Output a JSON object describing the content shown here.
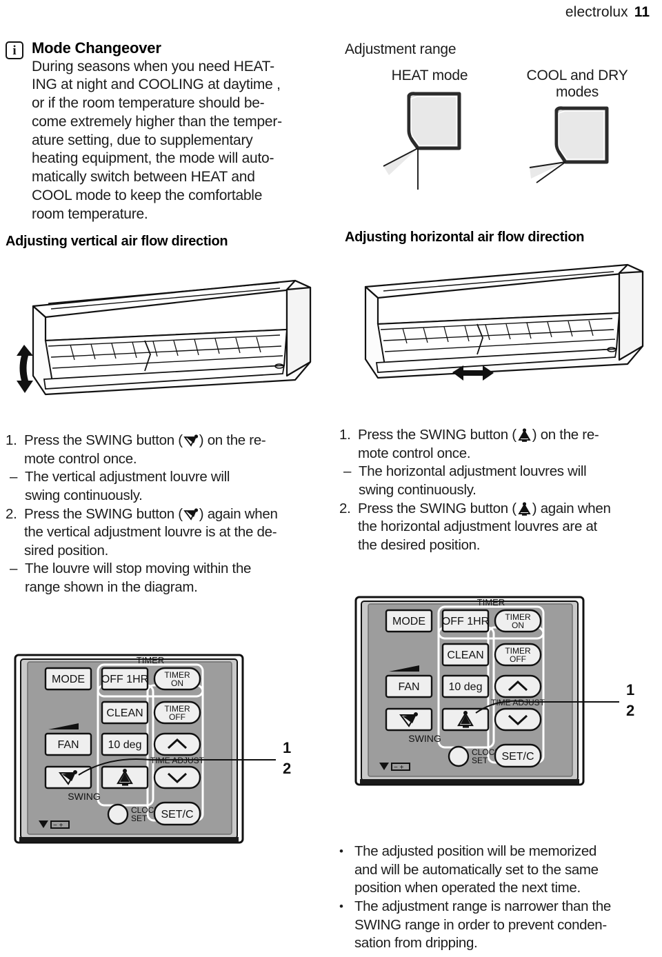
{
  "header": {
    "brand": "electrolux",
    "page_number": "11"
  },
  "note": {
    "icon": "info-icon",
    "title": "Mode Changeover",
    "body": "During seasons when you need HEAT-\nING at night and COOLING at daytime ,\nor if the room temperature should be-\ncome extremely higher than the temper-\nature setting, due to supplementary\nheating equipment, the mode will auto-\nmatically switch between HEAT and\nCOOL mode to keep the comfortable\nroom temperature."
  },
  "headings": {
    "vertical": "Adjusting vertical air flow direction",
    "horizontal": "Adjusting horizontal air flow direction"
  },
  "adjustment_range": {
    "label": "Adjustment range",
    "items": [
      {
        "caption": "HEAT mode",
        "figure": "louvre-heat-figure"
      },
      {
        "caption": "COOL and DRY\nmodes",
        "figure": "louvre-cool-figure"
      }
    ]
  },
  "illustrations": {
    "vertical_unit": "air-conditioner-unit-vertical-swing",
    "vertical_arrow": "up-down-arrow-icon",
    "horizontal_unit": "air-conditioner-unit-horizontal-swing",
    "horizontal_arrow": "left-right-arrow-icon"
  },
  "steps_vertical": [
    {
      "num": "1.",
      "text_before": "Press the SWING button (",
      "icon": "vertical-swing-icon",
      "text_after": ") on the re-\nmote control once.",
      "sub": "The vertical adjustment louvre will\nswing continuously.",
      "sub_dash": "–"
    },
    {
      "num": "2.",
      "text_before": "Press the SWING button (",
      "icon": "vertical-swing-icon",
      "text_after": ") again when\nthe vertical adjustment louvre is at the de-\nsired position.",
      "sub": "The louvre will stop moving within the\nrange shown in the diagram.",
      "sub_dash": "–"
    }
  ],
  "steps_horizontal": [
    {
      "num": "1.",
      "text_before": "Press the SWING button (",
      "icon": "horizontal-swing-icon",
      "text_after": ") on the re-\nmote control once.",
      "sub": "The horizontal adjustment louvres will\nswing continuously.",
      "sub_dash": "–"
    },
    {
      "num": "2.",
      "text_before": "Press the SWING button (",
      "icon": "horizontal-swing-icon",
      "text_after": ") again when\nthe horizontal adjustment louvres are at\nthe desired position.",
      "sub": "",
      "sub_dash": ""
    }
  ],
  "remote": {
    "timer_group_label": "TIMER",
    "time_adjust_label": "TIME ADJUST",
    "swing_label": "SWING",
    "clock_set_label": "CLOCK\nSET",
    "battery_label": "battery-indicator-icon",
    "buttons": {
      "mode": "MODE",
      "off_1hr": "OFF 1HR",
      "timer_on": "TIMER\nON",
      "clean": "CLEAN",
      "timer_off": "TIMER\nOFF",
      "fan": "FAN",
      "ten_deg": "10 deg",
      "up": "chevron-up-icon",
      "down": "chevron-down-icon",
      "swing_vertical": "vertical-swing-icon",
      "swing_horizontal": "horizontal-swing-icon",
      "set_c": "SET/C"
    },
    "callouts": {
      "one": "1",
      "two": "2"
    }
  },
  "bullet_notes": [
    {
      "bullet": "•",
      "text": "The adjusted position will be memorized\nand will be automatically set to the same\nposition when operated the next time."
    },
    {
      "bullet": "•",
      "text": "The adjustment range is narrower than the\nSWING range in order to prevent conden-\nsation from dripping."
    }
  ],
  "colors": {
    "ink": "#1a1a1a",
    "remote_body": "#9a9a9a",
    "remote_button": "#efefef",
    "louvre_fill": "#e2e2e2"
  }
}
